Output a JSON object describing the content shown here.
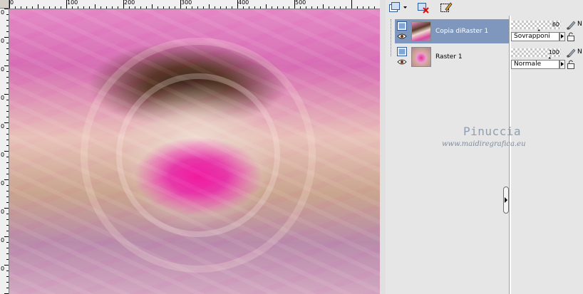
{
  "rulers": {
    "top_labels": [
      "0",
      "100",
      "200",
      "300",
      "400",
      "500"
    ],
    "left_labels": [
      "0",
      "0",
      "0",
      "0",
      "0",
      "0",
      "0",
      "0",
      "0",
      "0"
    ]
  },
  "toolbar": {
    "new_layer_icon": "new-layer-icon",
    "delete_layer_icon": "delete-layer-icon",
    "edit_selection_icon": "edit-selection-icon"
  },
  "layers": [
    {
      "name": "Copia diRaster 1",
      "selected": true,
      "opacity": "60",
      "blend_mode": "Sovrapponi",
      "extra_label": "N"
    },
    {
      "name": "Raster 1",
      "selected": false,
      "opacity": "100",
      "blend_mode": "Normale",
      "extra_label": "N"
    }
  ],
  "watermark": {
    "name": "Pinuccia",
    "url": "www.maidiregrafica.eu"
  },
  "colors": {
    "selection": "#7f96bd",
    "panel_bg": "#e6e6e6",
    "watermark": "#8f9fb0"
  }
}
